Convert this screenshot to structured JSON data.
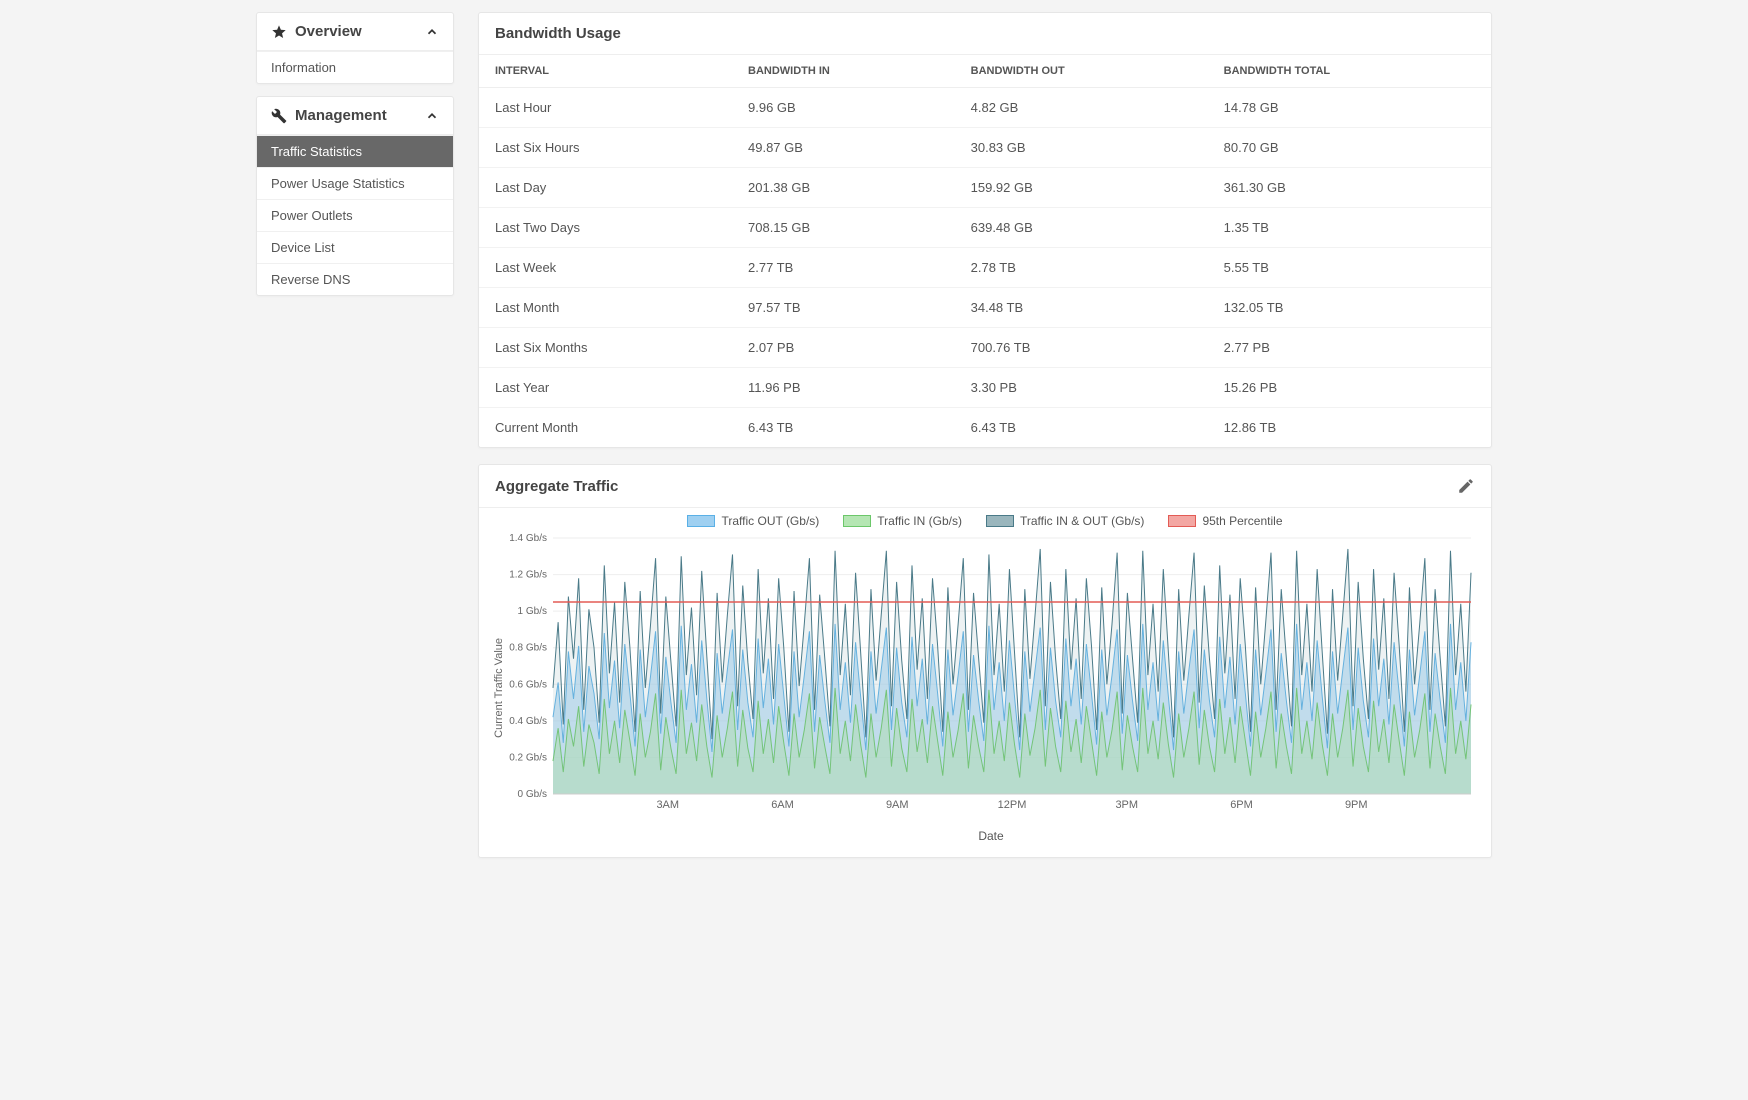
{
  "sidebar": {
    "sections": [
      {
        "title": "Overview",
        "icon": "star",
        "collapsed": false,
        "items": [
          "Information"
        ]
      },
      {
        "title": "Management",
        "icon": "wrench",
        "collapsed": false,
        "items": [
          "Traffic Statistics",
          "Power Usage Statistics",
          "Power Outlets",
          "Device List",
          "Reverse DNS"
        ],
        "active_index": 0
      }
    ]
  },
  "bandwidth_card": {
    "title": "Bandwidth Usage",
    "columns": [
      "INTERVAL",
      "BANDWIDTH IN",
      "BANDWIDTH OUT",
      "BANDWIDTH TOTAL"
    ],
    "rows": [
      {
        "interval": "Last Hour",
        "in": "9.96 GB",
        "out": "4.82 GB",
        "total": "14.78 GB"
      },
      {
        "interval": "Last Six Hours",
        "in": "49.87 GB",
        "out": "30.83 GB",
        "total": "80.70 GB"
      },
      {
        "interval": "Last Day",
        "in": "201.38 GB",
        "out": "159.92 GB",
        "total": "361.30 GB"
      },
      {
        "interval": "Last Two Days",
        "in": "708.15 GB",
        "out": "639.48 GB",
        "total": "1.35 TB"
      },
      {
        "interval": "Last Week",
        "in": "2.77 TB",
        "out": "2.78 TB",
        "total": "5.55 TB"
      },
      {
        "interval": "Last Month",
        "in": "97.57 TB",
        "out": "34.48 TB",
        "total": "132.05 TB"
      },
      {
        "interval": "Last Six Months",
        "in": "2.07 PB",
        "out": "700.76 TB",
        "total": "2.77 PB"
      },
      {
        "interval": "Last Year",
        "in": "11.96 PB",
        "out": "3.30 PB",
        "total": "15.26 PB"
      },
      {
        "interval": "Current Month",
        "in": "6.43 TB",
        "out": "6.43 TB",
        "total": "12.86 TB"
      }
    ]
  },
  "traffic_card": {
    "title": "Aggregate Traffic",
    "legend": [
      {
        "label": "Traffic OUT (Gb/s)",
        "fill": "#9fd0f1",
        "stroke": "#5ab0e6"
      },
      {
        "label": "Traffic IN (Gb/s)",
        "fill": "#b5e6b3",
        "stroke": "#6cc76a"
      },
      {
        "label": "Traffic IN & OUT (Gb/s)",
        "fill": "#9ab6bd",
        "stroke": "#4a7a88"
      },
      {
        "label": "95th Percentile",
        "fill": "#f3a7a3",
        "stroke": "#e35b55"
      }
    ]
  },
  "chart_data": {
    "type": "area",
    "xlabel": "Date",
    "ylabel": "Current Traffic Value",
    "y_ticks": [
      "0 Gb/s",
      "0.2 Gb/s",
      "0.4 Gb/s",
      "0.6 Gb/s",
      "0.8 Gb/s",
      "1 Gb/s",
      "1.2 Gb/s",
      "1.4 Gb/s"
    ],
    "ylim": [
      0,
      1.4
    ],
    "x_ticks": [
      "3AM",
      "6AM",
      "9AM",
      "12PM",
      "3PM",
      "6PM",
      "9PM"
    ],
    "percentile_95": 1.05,
    "x": [
      0,
      1,
      2,
      3,
      4,
      5,
      6,
      7,
      8,
      9,
      10,
      11,
      12,
      13,
      14,
      15,
      16,
      17,
      18,
      19,
      20,
      21,
      22,
      23,
      24,
      25,
      26,
      27,
      28,
      29,
      30,
      31,
      32,
      33,
      34,
      35,
      36,
      37,
      38,
      39,
      40,
      41,
      42,
      43,
      44,
      45,
      46,
      47,
      48,
      49,
      50,
      51,
      52,
      53,
      54,
      55,
      56,
      57,
      58,
      59,
      60,
      61,
      62,
      63,
      64,
      65,
      66,
      67,
      68,
      69,
      70,
      71,
      72,
      73,
      74,
      75,
      76,
      77,
      78,
      79,
      80,
      81,
      82,
      83,
      84,
      85,
      86,
      87,
      88,
      89,
      90,
      91,
      92,
      93,
      94,
      95,
      96,
      97,
      98,
      99,
      100,
      101,
      102,
      103,
      104,
      105,
      106,
      107,
      108,
      109,
      110,
      111,
      112,
      113,
      114,
      115,
      116,
      117,
      118,
      119,
      120,
      121,
      122,
      123,
      124,
      125,
      126,
      127,
      128,
      129,
      130,
      131,
      132,
      133,
      134,
      135,
      136,
      137,
      138,
      139,
      140,
      141,
      142,
      143,
      144,
      145,
      146,
      147,
      148,
      149,
      150,
      151,
      152,
      153,
      154,
      155,
      156,
      157,
      158,
      159,
      160,
      161,
      162,
      163,
      164,
      165,
      166,
      167,
      168,
      169,
      170,
      171,
      172,
      173,
      174,
      175,
      176,
      177,
      178,
      179
    ],
    "series": [
      {
        "name": "Traffic OUT (Gb/s)",
        "values": [
          0.42,
          0.61,
          0.28,
          0.78,
          0.52,
          0.81,
          0.34,
          0.7,
          0.55,
          0.3,
          0.88,
          0.47,
          0.73,
          0.36,
          0.82,
          0.55,
          0.26,
          0.79,
          0.42,
          0.64,
          0.89,
          0.33,
          0.75,
          0.5,
          0.28,
          0.92,
          0.46,
          0.71,
          0.39,
          0.84,
          0.52,
          0.23,
          0.77,
          0.44,
          0.68,
          0.9,
          0.35,
          0.79,
          0.5,
          0.31,
          0.85,
          0.47,
          0.74,
          0.38,
          0.82,
          0.54,
          0.26,
          0.78,
          0.42,
          0.65,
          0.89,
          0.34,
          0.76,
          0.51,
          0.28,
          0.93,
          0.46,
          0.72,
          0.39,
          0.83,
          0.53,
          0.24,
          0.78,
          0.44,
          0.68,
          0.91,
          0.35,
          0.8,
          0.5,
          0.31,
          0.86,
          0.48,
          0.74,
          0.38,
          0.82,
          0.55,
          0.26,
          0.79,
          0.43,
          0.65,
          0.89,
          0.34,
          0.76,
          0.51,
          0.29,
          0.92,
          0.46,
          0.72,
          0.4,
          0.84,
          0.53,
          0.24,
          0.78,
          0.45,
          0.68,
          0.91,
          0.35,
          0.8,
          0.51,
          0.31,
          0.85,
          0.48,
          0.74,
          0.38,
          0.82,
          0.55,
          0.27,
          0.79,
          0.43,
          0.65,
          0.9,
          0.33,
          0.76,
          0.51,
          0.29,
          0.93,
          0.46,
          0.72,
          0.4,
          0.84,
          0.53,
          0.24,
          0.78,
          0.44,
          0.68,
          0.9,
          0.36,
          0.79,
          0.51,
          0.31,
          0.86,
          0.47,
          0.75,
          0.38,
          0.82,
          0.55,
          0.26,
          0.79,
          0.43,
          0.66,
          0.9,
          0.34,
          0.77,
          0.51,
          0.28,
          0.93,
          0.46,
          0.72,
          0.4,
          0.84,
          0.53,
          0.25,
          0.78,
          0.44,
          0.68,
          0.91,
          0.35,
          0.8,
          0.51,
          0.31,
          0.85,
          0.48,
          0.74,
          0.38,
          0.83,
          0.55,
          0.26,
          0.79,
          0.43,
          0.65,
          0.89,
          0.34,
          0.77,
          0.51,
          0.28,
          0.93,
          0.46,
          0.72,
          0.4,
          0.83
        ]
      },
      {
        "name": "Traffic IN (Gb/s)",
        "values": [
          0.18,
          0.36,
          0.12,
          0.41,
          0.26,
          0.48,
          0.15,
          0.38,
          0.28,
          0.11,
          0.52,
          0.22,
          0.4,
          0.17,
          0.46,
          0.29,
          0.1,
          0.44,
          0.2,
          0.34,
          0.55,
          0.13,
          0.42,
          0.25,
          0.11,
          0.57,
          0.22,
          0.39,
          0.18,
          0.49,
          0.26,
          0.09,
          0.43,
          0.2,
          0.36,
          0.56,
          0.15,
          0.46,
          0.25,
          0.12,
          0.51,
          0.22,
          0.41,
          0.17,
          0.48,
          0.28,
          0.1,
          0.44,
          0.2,
          0.35,
          0.55,
          0.14,
          0.42,
          0.26,
          0.11,
          0.58,
          0.22,
          0.4,
          0.18,
          0.49,
          0.27,
          0.09,
          0.44,
          0.2,
          0.36,
          0.57,
          0.15,
          0.47,
          0.25,
          0.12,
          0.52,
          0.23,
          0.41,
          0.17,
          0.48,
          0.29,
          0.1,
          0.45,
          0.2,
          0.35,
          0.55,
          0.14,
          0.43,
          0.26,
          0.12,
          0.57,
          0.22,
          0.4,
          0.18,
          0.5,
          0.27,
          0.09,
          0.44,
          0.21,
          0.36,
          0.57,
          0.15,
          0.47,
          0.26,
          0.12,
          0.51,
          0.23,
          0.41,
          0.17,
          0.48,
          0.29,
          0.1,
          0.45,
          0.2,
          0.35,
          0.56,
          0.13,
          0.43,
          0.26,
          0.12,
          0.58,
          0.22,
          0.4,
          0.19,
          0.5,
          0.27,
          0.09,
          0.44,
          0.2,
          0.36,
          0.56,
          0.16,
          0.46,
          0.26,
          0.12,
          0.52,
          0.22,
          0.42,
          0.17,
          0.48,
          0.29,
          0.1,
          0.45,
          0.2,
          0.36,
          0.56,
          0.14,
          0.44,
          0.26,
          0.11,
          0.58,
          0.22,
          0.4,
          0.19,
          0.5,
          0.27,
          0.1,
          0.44,
          0.2,
          0.36,
          0.57,
          0.15,
          0.47,
          0.26,
          0.12,
          0.51,
          0.23,
          0.41,
          0.17,
          0.49,
          0.29,
          0.1,
          0.45,
          0.2,
          0.35,
          0.55,
          0.14,
          0.44,
          0.26,
          0.11,
          0.58,
          0.22,
          0.4,
          0.19,
          0.49
        ]
      },
      {
        "name": "Traffic IN & OUT (Gb/s)",
        "values": [
          0.58,
          0.94,
          0.38,
          1.08,
          0.74,
          1.18,
          0.46,
          1.01,
          0.8,
          0.39,
          1.25,
          0.66,
          1.05,
          0.5,
          1.16,
          0.8,
          0.34,
          1.11,
          0.58,
          0.92,
          1.29,
          0.44,
          1.08,
          0.72,
          0.37,
          1.3,
          0.65,
          1.02,
          0.54,
          1.22,
          0.75,
          0.3,
          1.1,
          0.61,
          0.98,
          1.31,
          0.48,
          1.14,
          0.72,
          0.41,
          1.23,
          0.66,
          1.07,
          0.52,
          1.18,
          0.8,
          0.34,
          1.11,
          0.59,
          0.93,
          1.29,
          0.46,
          1.09,
          0.74,
          0.37,
          1.33,
          0.65,
          1.04,
          0.54,
          1.21,
          0.77,
          0.31,
          1.12,
          0.62,
          0.98,
          1.33,
          0.48,
          1.16,
          0.73,
          0.41,
          1.25,
          0.68,
          1.07,
          0.52,
          1.18,
          0.81,
          0.34,
          1.13,
          0.6,
          0.93,
          1.29,
          0.46,
          1.1,
          0.74,
          0.39,
          1.31,
          0.65,
          1.04,
          0.56,
          1.23,
          0.77,
          0.31,
          1.12,
          0.63,
          0.98,
          1.34,
          0.48,
          1.16,
          0.74,
          0.41,
          1.23,
          0.68,
          1.07,
          0.52,
          1.18,
          0.81,
          0.35,
          1.13,
          0.6,
          0.93,
          1.32,
          0.44,
          1.1,
          0.74,
          0.39,
          1.33,
          0.65,
          1.04,
          0.56,
          1.23,
          0.77,
          0.31,
          1.12,
          0.62,
          0.98,
          1.32,
          0.5,
          1.14,
          0.74,
          0.41,
          1.25,
          0.66,
          1.09,
          0.52,
          1.18,
          0.81,
          0.34,
          1.13,
          0.6,
          0.95,
          1.32,
          0.46,
          1.12,
          0.74,
          0.37,
          1.33,
          0.65,
          1.04,
          0.56,
          1.23,
          0.77,
          0.33,
          1.12,
          0.62,
          0.98,
          1.34,
          0.48,
          1.16,
          0.74,
          0.41,
          1.23,
          0.68,
          1.07,
          0.52,
          1.21,
          0.81,
          0.34,
          1.13,
          0.6,
          0.93,
          1.29,
          0.46,
          1.12,
          0.74,
          0.37,
          1.33,
          0.65,
          1.04,
          0.56,
          1.21
        ]
      }
    ]
  }
}
